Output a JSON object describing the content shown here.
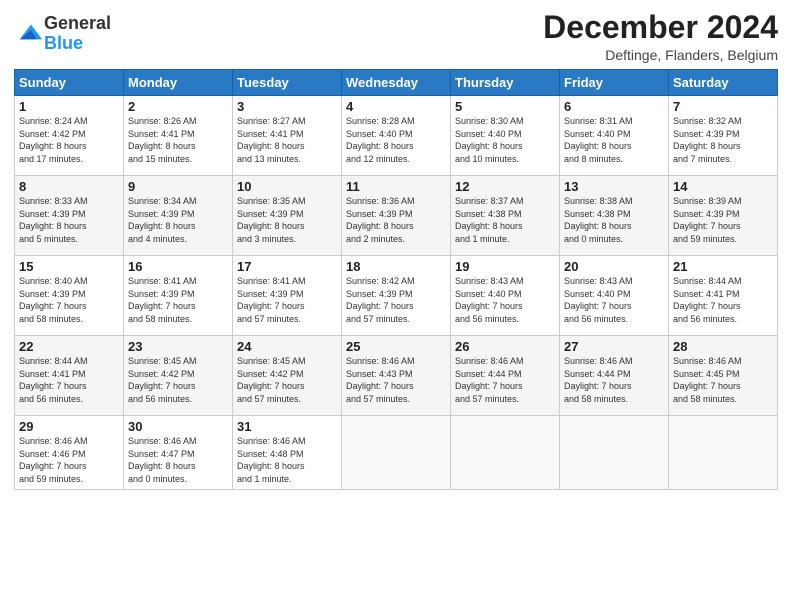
{
  "header": {
    "logo": {
      "general": "General",
      "blue": "Blue"
    },
    "title": "December 2024",
    "location": "Deftinge, Flanders, Belgium"
  },
  "calendar": {
    "days_of_week": [
      "Sunday",
      "Monday",
      "Tuesday",
      "Wednesday",
      "Thursday",
      "Friday",
      "Saturday"
    ],
    "weeks": [
      [
        {
          "day": "",
          "info": ""
        },
        {
          "day": "2",
          "info": "Sunrise: 8:26 AM\nSunset: 4:41 PM\nDaylight: 8 hours\nand 15 minutes."
        },
        {
          "day": "3",
          "info": "Sunrise: 8:27 AM\nSunset: 4:41 PM\nDaylight: 8 hours\nand 13 minutes."
        },
        {
          "day": "4",
          "info": "Sunrise: 8:28 AM\nSunset: 4:40 PM\nDaylight: 8 hours\nand 12 minutes."
        },
        {
          "day": "5",
          "info": "Sunrise: 8:30 AM\nSunset: 4:40 PM\nDaylight: 8 hours\nand 10 minutes."
        },
        {
          "day": "6",
          "info": "Sunrise: 8:31 AM\nSunset: 4:40 PM\nDaylight: 8 hours\nand 8 minutes."
        },
        {
          "day": "7",
          "info": "Sunrise: 8:32 AM\nSunset: 4:39 PM\nDaylight: 8 hours\nand 7 minutes."
        }
      ],
      [
        {
          "day": "1",
          "info": "Sunrise: 8:24 AM\nSunset: 4:42 PM\nDaylight: 8 hours\nand 17 minutes."
        },
        {
          "day": "",
          "info": ""
        },
        {
          "day": "",
          "info": ""
        },
        {
          "day": "",
          "info": ""
        },
        {
          "day": "",
          "info": ""
        },
        {
          "day": "",
          "info": ""
        },
        {
          "day": "",
          "info": ""
        }
      ],
      [
        {
          "day": "8",
          "info": "Sunrise: 8:33 AM\nSunset: 4:39 PM\nDaylight: 8 hours\nand 5 minutes."
        },
        {
          "day": "9",
          "info": "Sunrise: 8:34 AM\nSunset: 4:39 PM\nDaylight: 8 hours\nand 4 minutes."
        },
        {
          "day": "10",
          "info": "Sunrise: 8:35 AM\nSunset: 4:39 PM\nDaylight: 8 hours\nand 3 minutes."
        },
        {
          "day": "11",
          "info": "Sunrise: 8:36 AM\nSunset: 4:39 PM\nDaylight: 8 hours\nand 2 minutes."
        },
        {
          "day": "12",
          "info": "Sunrise: 8:37 AM\nSunset: 4:38 PM\nDaylight: 8 hours\nand 1 minute."
        },
        {
          "day": "13",
          "info": "Sunrise: 8:38 AM\nSunset: 4:38 PM\nDaylight: 8 hours\nand 0 minutes."
        },
        {
          "day": "14",
          "info": "Sunrise: 8:39 AM\nSunset: 4:39 PM\nDaylight: 7 hours\nand 59 minutes."
        }
      ],
      [
        {
          "day": "15",
          "info": "Sunrise: 8:40 AM\nSunset: 4:39 PM\nDaylight: 7 hours\nand 58 minutes."
        },
        {
          "day": "16",
          "info": "Sunrise: 8:41 AM\nSunset: 4:39 PM\nDaylight: 7 hours\nand 58 minutes."
        },
        {
          "day": "17",
          "info": "Sunrise: 8:41 AM\nSunset: 4:39 PM\nDaylight: 7 hours\nand 57 minutes."
        },
        {
          "day": "18",
          "info": "Sunrise: 8:42 AM\nSunset: 4:39 PM\nDaylight: 7 hours\nand 57 minutes."
        },
        {
          "day": "19",
          "info": "Sunrise: 8:43 AM\nSunset: 4:40 PM\nDaylight: 7 hours\nand 56 minutes."
        },
        {
          "day": "20",
          "info": "Sunrise: 8:43 AM\nSunset: 4:40 PM\nDaylight: 7 hours\nand 56 minutes."
        },
        {
          "day": "21",
          "info": "Sunrise: 8:44 AM\nSunset: 4:41 PM\nDaylight: 7 hours\nand 56 minutes."
        }
      ],
      [
        {
          "day": "22",
          "info": "Sunrise: 8:44 AM\nSunset: 4:41 PM\nDaylight: 7 hours\nand 56 minutes."
        },
        {
          "day": "23",
          "info": "Sunrise: 8:45 AM\nSunset: 4:42 PM\nDaylight: 7 hours\nand 56 minutes."
        },
        {
          "day": "24",
          "info": "Sunrise: 8:45 AM\nSunset: 4:42 PM\nDaylight: 7 hours\nand 57 minutes."
        },
        {
          "day": "25",
          "info": "Sunrise: 8:46 AM\nSunset: 4:43 PM\nDaylight: 7 hours\nand 57 minutes."
        },
        {
          "day": "26",
          "info": "Sunrise: 8:46 AM\nSunset: 4:44 PM\nDaylight: 7 hours\nand 57 minutes."
        },
        {
          "day": "27",
          "info": "Sunrise: 8:46 AM\nSunset: 4:44 PM\nDaylight: 7 hours\nand 58 minutes."
        },
        {
          "day": "28",
          "info": "Sunrise: 8:46 AM\nSunset: 4:45 PM\nDaylight: 7 hours\nand 58 minutes."
        }
      ],
      [
        {
          "day": "29",
          "info": "Sunrise: 8:46 AM\nSunset: 4:46 PM\nDaylight: 7 hours\nand 59 minutes."
        },
        {
          "day": "30",
          "info": "Sunrise: 8:46 AM\nSunset: 4:47 PM\nDaylight: 8 hours\nand 0 minutes."
        },
        {
          "day": "31",
          "info": "Sunrise: 8:46 AM\nSunset: 4:48 PM\nDaylight: 8 hours\nand 1 minute."
        },
        {
          "day": "",
          "info": ""
        },
        {
          "day": "",
          "info": ""
        },
        {
          "day": "",
          "info": ""
        },
        {
          "day": "",
          "info": ""
        }
      ]
    ]
  }
}
